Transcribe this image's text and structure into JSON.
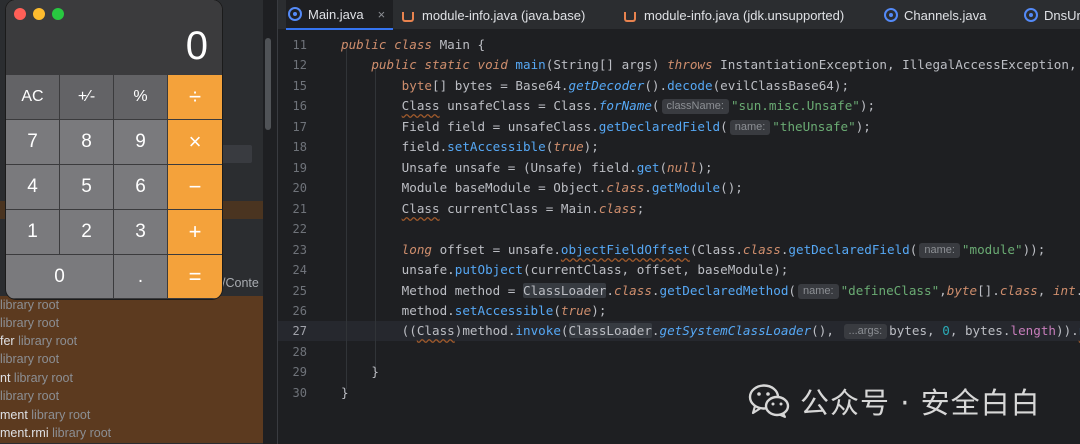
{
  "tabs": [
    {
      "label": "Main.java",
      "icon": "java-class-icon",
      "active": true
    },
    {
      "label": "module-info.java (java.base)",
      "icon": "java-module-icon"
    },
    {
      "label": "module-info.java (jdk.unsupported)",
      "icon": "java-module-icon"
    },
    {
      "label": "Channels.java",
      "icon": "java-class-icon"
    },
    {
      "label": "DnsUr",
      "icon": "java-class-icon"
    }
  ],
  "tab_close_glyph": "×",
  "project": {
    "contents_label": "/Conte",
    "rows": [
      {
        "name": "",
        "suffix": "library root"
      },
      {
        "name": "",
        "suffix": "library root"
      },
      {
        "name": "fer",
        "suffix": "library root"
      },
      {
        "name": "",
        "suffix": "library root"
      },
      {
        "name": "nt",
        "suffix": "library root"
      },
      {
        "name": "",
        "suffix": "library root"
      },
      {
        "name": "ment",
        "suffix": "library root"
      },
      {
        "name": "ment.rmi",
        "suffix": "library root"
      }
    ]
  },
  "editor": {
    "line_numbers": [
      "11",
      "12",
      "15",
      "16",
      "17",
      "18",
      "19",
      "20",
      "21",
      "22",
      "23",
      "24",
      "25",
      "26",
      "27",
      "28",
      "29",
      "30"
    ],
    "current_line": "27",
    "hints": {
      "className": "className:",
      "name": "name:",
      "args": "...args:"
    },
    "strings": {
      "unsafe_class": "\"sun.misc.Unsafe\"",
      "the_unsafe": "\"theUnsafe\"",
      "module": "\"module\"",
      "define_class": "\"defineClass\""
    }
  },
  "calculator": {
    "display": "0",
    "keys": [
      {
        "label": "AC",
        "type": "function"
      },
      {
        "label": "+∕-",
        "type": "function"
      },
      {
        "label": "%",
        "type": "function"
      },
      {
        "label": "÷",
        "type": "operator"
      },
      {
        "label": "7",
        "type": "digit"
      },
      {
        "label": "8",
        "type": "digit"
      },
      {
        "label": "9",
        "type": "digit"
      },
      {
        "label": "×",
        "type": "operator"
      },
      {
        "label": "4",
        "type": "digit"
      },
      {
        "label": "5",
        "type": "digit"
      },
      {
        "label": "6",
        "type": "digit"
      },
      {
        "label": "−",
        "type": "operator"
      },
      {
        "label": "1",
        "type": "digit"
      },
      {
        "label": "2",
        "type": "digit"
      },
      {
        "label": "3",
        "type": "digit"
      },
      {
        "label": "+",
        "type": "operator"
      },
      {
        "label": "0",
        "type": "digit"
      },
      {
        "label": ".",
        "type": "digit"
      },
      {
        "label": "=",
        "type": "operator"
      }
    ],
    "colors": {
      "operator": "#f4a23b",
      "digit": "#7a7a7d",
      "function": "#636366"
    }
  },
  "watermark": {
    "text": "公众号 · 安全白白",
    "icon": "wechat-icon"
  }
}
